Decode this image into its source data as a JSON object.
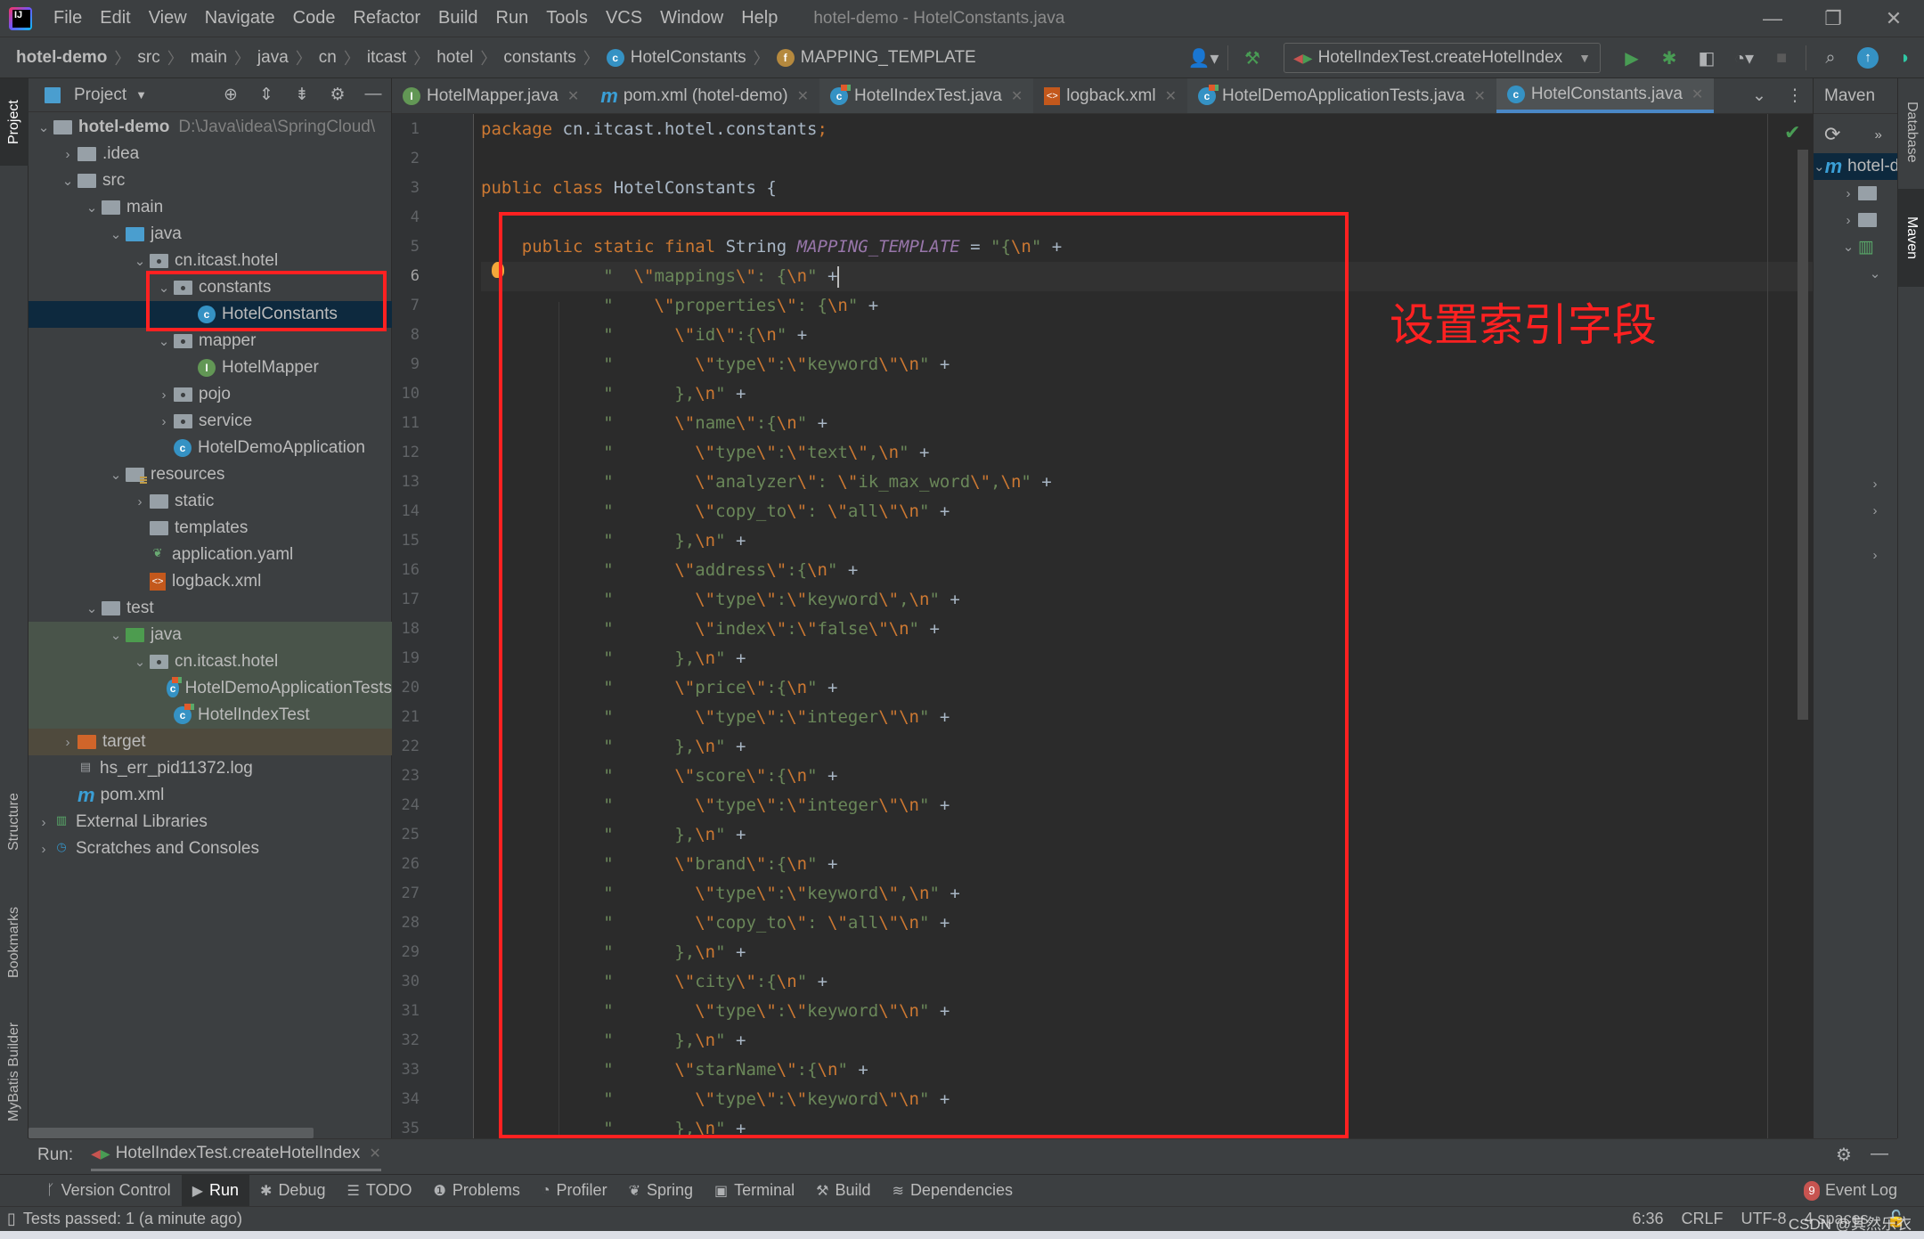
{
  "window": {
    "title": "hotel-demo - HotelConstants.java",
    "menu": [
      "File",
      "Edit",
      "View",
      "Navigate",
      "Code",
      "Refactor",
      "Build",
      "Run",
      "Tools",
      "VCS",
      "Window",
      "Help"
    ],
    "controls": {
      "minimize": "—",
      "restore": "❐",
      "close": "✕"
    }
  },
  "breadcrumb": [
    "hotel-demo",
    "src",
    "main",
    "java",
    "cn",
    "itcast",
    "hotel",
    "constants",
    "HotelConstants",
    "MAPPING_TEMPLATE"
  ],
  "toolbar": {
    "run_config": "HotelIndexTest.createHotelIndex",
    "icons": [
      "user-icon",
      "build-hammer-icon",
      "run-icon",
      "debug-icon",
      "coverage-icon",
      "profile-icon",
      "stop-icon",
      "search-icon",
      "update-icon",
      "toolbox-icon"
    ]
  },
  "left_stripe": [
    "Project",
    "Structure",
    "Bookmarks",
    "MyBatis Builder"
  ],
  "project": {
    "title": "Project",
    "root_path": "D:\\Java\\idea\\SpringCloud\\",
    "tree": [
      {
        "label": "hotel-demo",
        "depth": 0,
        "expanded": true,
        "icon": "module"
      },
      {
        "label": ".idea",
        "depth": 1,
        "expanded": false,
        "icon": "folder"
      },
      {
        "label": "src",
        "depth": 1,
        "expanded": true,
        "icon": "folder"
      },
      {
        "label": "main",
        "depth": 2,
        "expanded": true,
        "icon": "folder"
      },
      {
        "label": "java",
        "depth": 3,
        "expanded": true,
        "icon": "source-folder"
      },
      {
        "label": "cn.itcast.hotel",
        "depth": 4,
        "expanded": true,
        "icon": "package"
      },
      {
        "label": "constants",
        "depth": 5,
        "expanded": true,
        "icon": "package"
      },
      {
        "label": "HotelConstants",
        "depth": 6,
        "icon": "class",
        "selected": true
      },
      {
        "label": "mapper",
        "depth": 5,
        "expanded": true,
        "icon": "package"
      },
      {
        "label": "HotelMapper",
        "depth": 6,
        "icon": "interface"
      },
      {
        "label": "pojo",
        "depth": 5,
        "expanded": false,
        "icon": "package"
      },
      {
        "label": "service",
        "depth": 5,
        "expanded": false,
        "icon": "package"
      },
      {
        "label": "HotelDemoApplication",
        "depth": 5,
        "icon": "spring-class"
      },
      {
        "label": "resources",
        "depth": 3,
        "expanded": true,
        "icon": "resources"
      },
      {
        "label": "static",
        "depth": 4,
        "expanded": false,
        "icon": "folder"
      },
      {
        "label": "templates",
        "depth": 4,
        "icon": "folder"
      },
      {
        "label": "application.yaml",
        "depth": 4,
        "icon": "spring-yaml"
      },
      {
        "label": "logback.xml",
        "depth": 4,
        "icon": "xml"
      },
      {
        "label": "test",
        "depth": 2,
        "expanded": true,
        "icon": "folder"
      },
      {
        "label": "java",
        "depth": 3,
        "expanded": true,
        "icon": "test-folder"
      },
      {
        "label": "cn.itcast.hotel",
        "depth": 4,
        "expanded": true,
        "icon": "package"
      },
      {
        "label": "HotelDemoApplicationTests",
        "depth": 5,
        "icon": "test-class"
      },
      {
        "label": "HotelIndexTest",
        "depth": 5,
        "icon": "test-class"
      },
      {
        "label": "target",
        "depth": 1,
        "expanded": false,
        "icon": "excluded-folder"
      },
      {
        "label": "hs_err_pid11372.log",
        "depth": 1,
        "icon": "log"
      },
      {
        "label": "pom.xml",
        "depth": 1,
        "icon": "maven"
      },
      {
        "label": "External Libraries",
        "depth": 0,
        "expanded": false,
        "icon": "libraries"
      },
      {
        "label": "Scratches and Consoles",
        "depth": 0,
        "expanded": false,
        "icon": "scratches"
      }
    ]
  },
  "tabs": [
    {
      "label": "HotelMapper.java",
      "icon": "interface"
    },
    {
      "label": "pom.xml (hotel-demo)",
      "icon": "maven"
    },
    {
      "label": "HotelIndexTest.java",
      "icon": "test-class"
    },
    {
      "label": "logback.xml",
      "icon": "xml"
    },
    {
      "label": "HotelDemoApplicationTests.java",
      "icon": "test-class"
    },
    {
      "label": "HotelConstants.java",
      "icon": "class",
      "active": true
    }
  ],
  "editor": {
    "current_line": 6,
    "annotation": "设置索引字段",
    "lines": [
      "package cn.itcast.hotel.constants;",
      "",
      "public class HotelConstants {",
      "",
      "    public static final String MAPPING_TEMPLATE = \"{\\n\" +",
      "            \"  \\\"mappings\\\": {\\n\" +",
      "            \"    \\\"properties\\\": {\\n\" +",
      "            \"      \\\"id\\\":{\\n\" +",
      "            \"        \\\"type\\\":\\\"keyword\\\"\\n\" +",
      "            \"      },\\n\" +",
      "            \"      \\\"name\\\":{\\n\" +",
      "            \"        \\\"type\\\":\\\"text\\\",\\n\" +",
      "            \"        \\\"analyzer\\\": \\\"ik_max_word\\\",\\n\" +",
      "            \"        \\\"copy_to\\\": \\\"all\\\"\\n\" +",
      "            \"      },\\n\" +",
      "            \"      \\\"address\\\":{\\n\" +",
      "            \"        \\\"type\\\":\\\"keyword\\\",\\n\" +",
      "            \"        \\\"index\\\":\\\"false\\\"\\n\" +",
      "            \"      },\\n\" +",
      "            \"      \\\"price\\\":{\\n\" +",
      "            \"        \\\"type\\\":\\\"integer\\\"\\n\" +",
      "            \"      },\\n\" +",
      "            \"      \\\"score\\\":{\\n\" +",
      "            \"        \\\"type\\\":\\\"integer\\\"\\n\" +",
      "            \"      },\\n\" +",
      "            \"      \\\"brand\\\":{\\n\" +",
      "            \"        \\\"type\\\":\\\"keyword\\\",\\n\" +",
      "            \"        \\\"copy_to\\\": \\\"all\\\"\\n\" +",
      "            \"      },\\n\" +",
      "            \"      \\\"city\\\":{\\n\" +",
      "            \"        \\\"type\\\":\\\"keyword\\\"\\n\" +",
      "            \"      },\\n\" +",
      "            \"      \\\"starName\\\":{\\n\" +",
      "            \"        \\\"type\\\":\\\"keyword\\\"\\n\" +",
      "            \"      },\\n\" +"
    ]
  },
  "maven": {
    "title": "Maven",
    "root": "hotel-demo"
  },
  "right_stripe": [
    "Database",
    "Maven"
  ],
  "run_panel": {
    "label": "Run:",
    "tab": "HotelIndexTest.createHotelIndex"
  },
  "tool_windows": [
    {
      "label": "Version Control",
      "icon": "ᚴ"
    },
    {
      "label": "Run",
      "icon": "▶",
      "active": true
    },
    {
      "label": "Debug",
      "icon": "✱"
    },
    {
      "label": "TODO",
      "icon": "☰"
    },
    {
      "label": "Problems",
      "icon": "❶"
    },
    {
      "label": "Profiler",
      "icon": "◔"
    },
    {
      "label": "Spring",
      "icon": "❦"
    },
    {
      "label": "Terminal",
      "icon": "▣"
    },
    {
      "label": "Build",
      "icon": "⚒"
    },
    {
      "label": "Dependencies",
      "icon": "≋"
    }
  ],
  "event_log": {
    "label": "Event Log",
    "count": "9"
  },
  "status": {
    "message": "Tests passed: 1 (a minute ago)",
    "position": "6:36",
    "line_sep": "CRLF",
    "encoding": "UTF-8",
    "indent": "4 spaces"
  },
  "watermark": "CSDN @其然乐衣",
  "colors": {
    "keyword": "#cc7832",
    "string": "#6a8759",
    "constant": "#9876aa",
    "annotation_red": "#ff2121",
    "selection": "#0d293e",
    "accent_tab": "#4a88c7"
  }
}
